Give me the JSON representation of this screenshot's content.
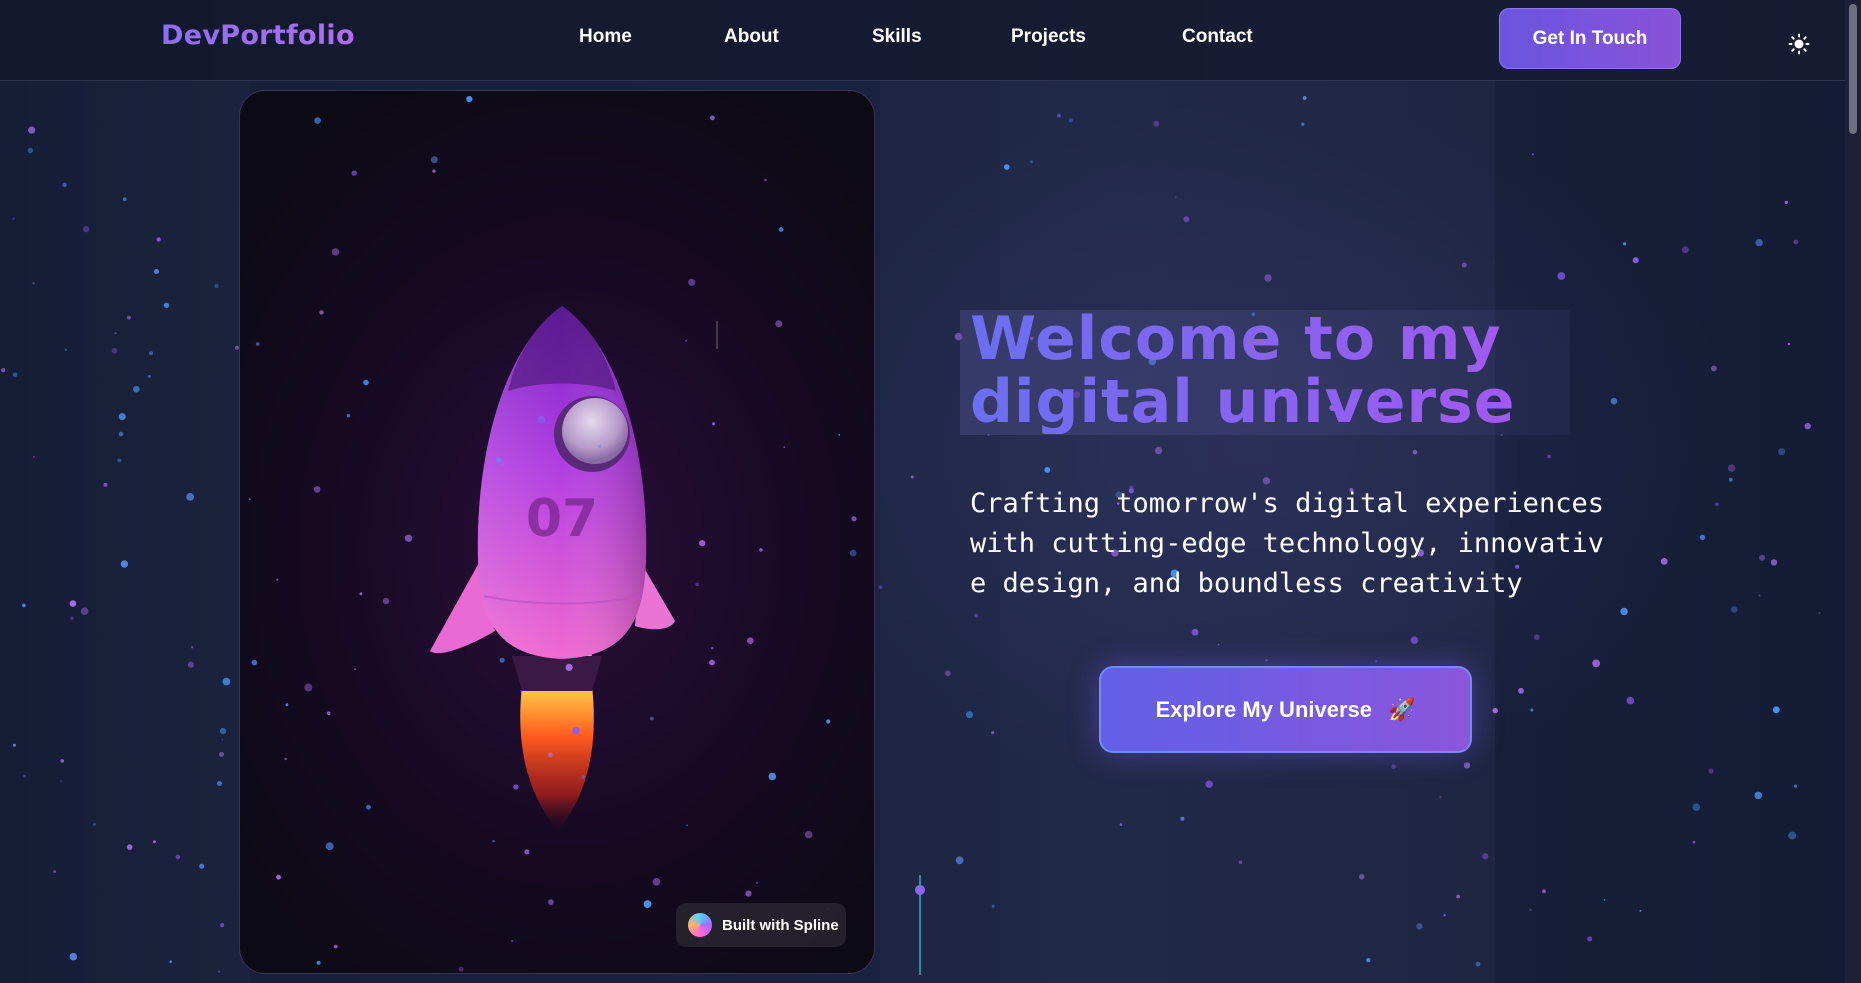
{
  "header": {
    "logo": "DevPortfolio",
    "nav": [
      {
        "label": "Home"
      },
      {
        "label": "About"
      },
      {
        "label": "Skills"
      },
      {
        "label": "Projects"
      },
      {
        "label": "Contact"
      }
    ],
    "cta_label": "Get In Touch",
    "theme_icon": "sun-icon"
  },
  "card": {
    "rocket_number": "07",
    "badge_label": "Built with Spline"
  },
  "hero": {
    "title_line1": "Welcome to my",
    "title_line2": "digital universe",
    "subtitle": "Crafting tomorrow's digital experiences with cutting-edge technology, innovative design, and boundless creativity",
    "cta_label": "Explore My Universe",
    "cta_icon": "🚀"
  },
  "colors": {
    "accent_start": "#6a55e0",
    "accent_end": "#8a52d8",
    "title_gradient_start": "#6a6ff0",
    "title_gradient_end": "#a25af0",
    "background": "#141b33"
  }
}
